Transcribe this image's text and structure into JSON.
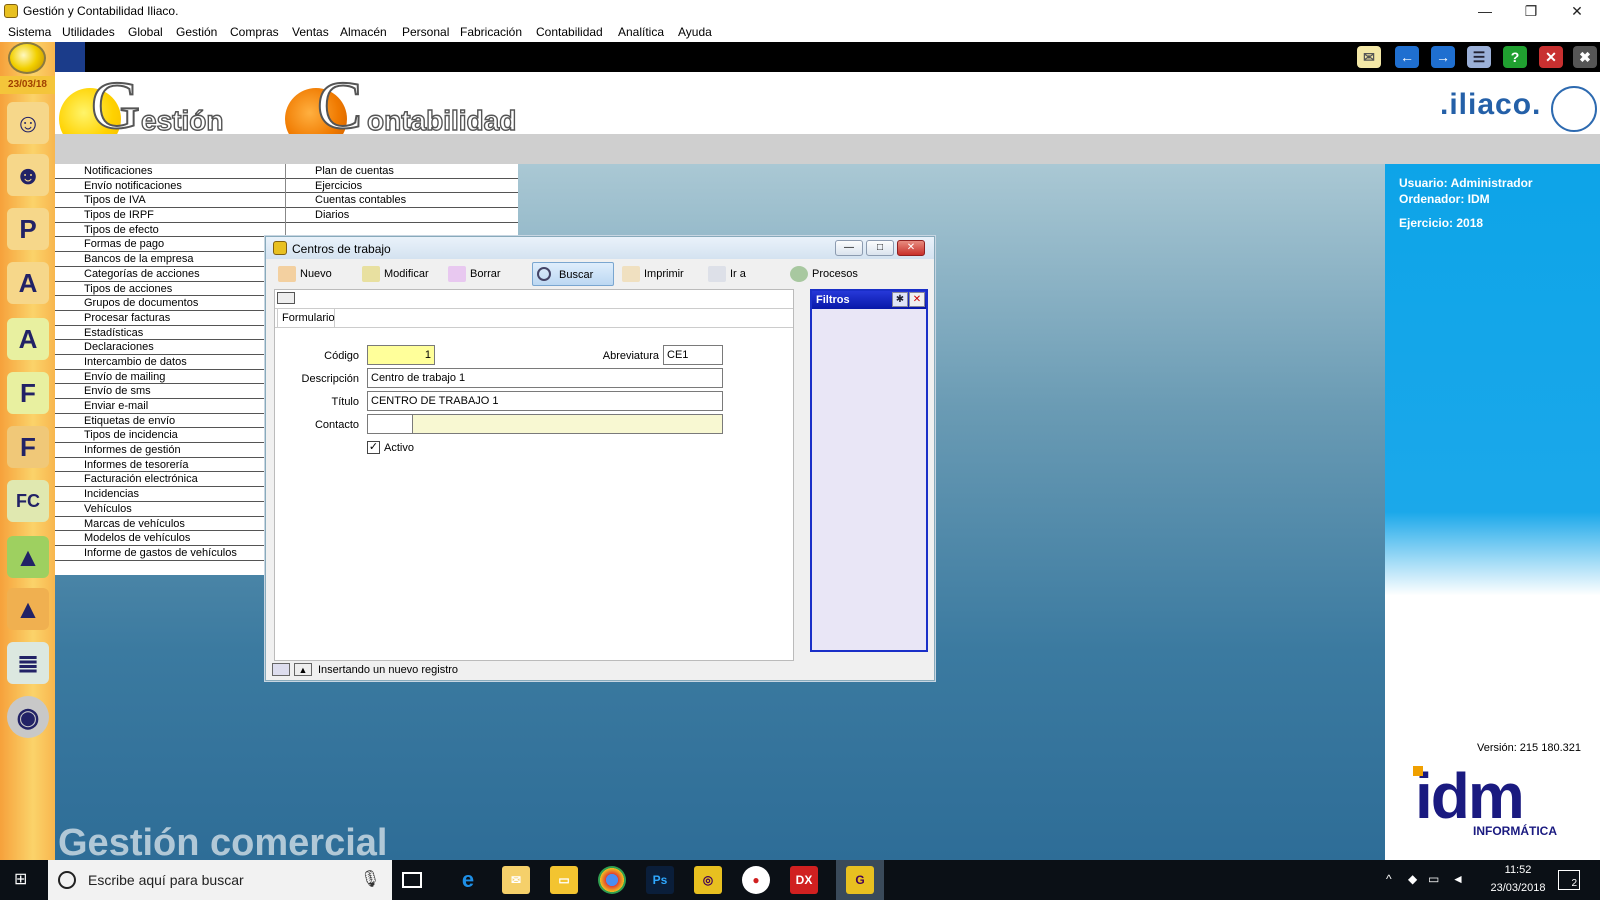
{
  "window": {
    "title": "Gestión y Contabilidad Iliaco.",
    "minimize": "—",
    "restore": "❐",
    "close": "✕"
  },
  "menu": [
    "Sistema",
    "Utilidades",
    "Global",
    "Gestión",
    "Compras",
    "Ventas",
    "Almacén",
    "Personal",
    "Fabricación",
    "Contabilidad",
    "Analítica",
    "Ayuda"
  ],
  "sidebar": {
    "date": "23/03/18"
  },
  "header": {
    "gestion_big": "G",
    "gestion_rest": "estión",
    "conta_big": "C",
    "conta_rest": "ontabilidad",
    "brand": ".iliaco."
  },
  "left_list": [
    "Notificaciones",
    "Envío notificaciones",
    "Tipos de IVA",
    "Tipos de IRPF",
    "Tipos de efecto",
    "Formas de pago",
    "Bancos de la empresa",
    "Categorías de acciones",
    "Tipos de acciones",
    "Grupos de documentos",
    "Procesar facturas",
    "Estadísticas",
    "Declaraciones",
    "Intercambio de datos",
    "Envío de mailing",
    "Envío de sms",
    "Enviar e-mail",
    "Etiquetas de envío",
    "Tipos de incidencia",
    "Informes de gestión",
    "Informes de tesorería",
    "Facturación electrónica",
    "Incidencias",
    "Vehículos",
    "Marcas de vehículos",
    "Modelos de vehículos",
    "Informe de gastos de vehículos"
  ],
  "right_list": [
    "Plan de cuentas",
    "Ejercicios",
    "Cuentas contables",
    "Diarios"
  ],
  "info": {
    "usuario": "Usuario: Administrador",
    "ordenador": "Ordenador: IDM",
    "ejercicio": "Ejercicio: 2018",
    "version": "Versión: 215 180.321",
    "idm_logo": "idm",
    "idm_sub": "INFORMÁTICA"
  },
  "watermark": "Gestión comercial",
  "dialog": {
    "title": "Centros de trabajo",
    "toolbar": [
      "Nuevo",
      "Modificar",
      "Borrar",
      "Buscar",
      "Imprimir",
      "Ir a",
      "Procesos"
    ],
    "tab": "Formulario",
    "fields": {
      "codigo_label": "Código",
      "codigo_value": "1",
      "abreviatura_label": "Abreviatura",
      "abreviatura_value": "CE1",
      "descripcion_label": "Descripción",
      "descripcion_value": "Centro de trabajo 1",
      "titulo_label": "Título",
      "titulo_value": "CENTRO DE TRABAJO 1",
      "contacto_label": "Contacto",
      "contacto_value": "",
      "activo_label": "Activo",
      "activo_checked": true
    },
    "filtros": "Filtros",
    "status": "Insertando un nuevo registro"
  },
  "taskbar": {
    "search_placeholder": "Escribe aquí para buscar",
    "time": "11:52",
    "date": "23/03/2018",
    "notifications": "2"
  }
}
